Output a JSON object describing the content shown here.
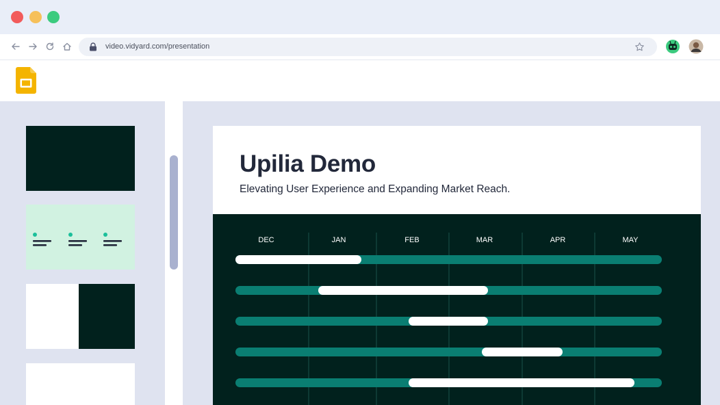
{
  "browser": {
    "url": "video.vidyard.com/presentation",
    "traffic_lights": [
      "#f25b5b",
      "#f6c05a",
      "#3ccb7f"
    ]
  },
  "app": {
    "name_icon": "google-slides-icon",
    "accent": "#f4b400"
  },
  "slide": {
    "title": "Upilia Demo",
    "subtitle": "Elevating User Experience and Expanding Market Reach.",
    "timeline_bg": "#01211d",
    "track_color": "#0a7e72",
    "bar_color": "#ffffff"
  },
  "timeline": {
    "months": [
      "DEC",
      "JAN",
      "FEB",
      "MAR",
      "APR",
      "MAY"
    ],
    "rows": [
      {
        "start": 0.0,
        "end": 0.296
      },
      {
        "start": 0.195,
        "end": 0.592
      },
      {
        "start": 0.406,
        "end": 0.592
      },
      {
        "start": 0.578,
        "end": 0.768
      },
      {
        "start": 0.406,
        "end": 0.935
      }
    ]
  },
  "thumbnails": [
    "dark-slide",
    "icons-slide",
    "split-slide",
    "white-slide"
  ]
}
